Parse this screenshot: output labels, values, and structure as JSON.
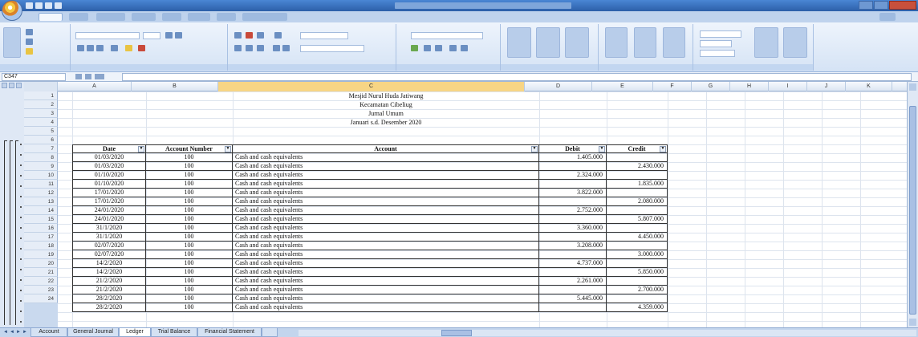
{
  "formula_bar": {
    "name_box": "C347",
    "formula": ""
  },
  "columns": [
    "A",
    "B",
    "C",
    "D",
    "E",
    "F",
    "G",
    "H",
    "I",
    "J",
    "K"
  ],
  "selected_column": "C",
  "report": {
    "title_lines": [
      "Mesjid Nurul Huda Jatiwang",
      "Kecamatan Cibeliug",
      "Jurnal Umum",
      "Januari s.d. Desember 2020"
    ]
  },
  "table": {
    "headers": [
      "Date",
      "Account Number",
      "Account",
      "Debit",
      "Credit"
    ],
    "rows": [
      {
        "row": "1",
        "date": "",
        "acct_no": "",
        "account": "",
        "debit": "",
        "credit": ""
      },
      {
        "row": "7",
        "date": "01/03/2020",
        "acct_no": "100",
        "account": "Cash and cash equivalents",
        "debit": "1.405.000",
        "credit": ""
      },
      {
        "row": "8",
        "date": "01/03/2020",
        "acct_no": "100",
        "account": "Cash and cash equivalents",
        "debit": "",
        "credit": "2.430.000"
      },
      {
        "row": "9",
        "date": "01/10/2020",
        "acct_no": "100",
        "account": "Cash and cash equivalents",
        "debit": "2.324.000",
        "credit": ""
      },
      {
        "row": "10",
        "date": "01/10/2020",
        "acct_no": "100",
        "account": "Cash and cash equivalents",
        "debit": "",
        "credit": "1.835.000"
      },
      {
        "row": "11",
        "date": "17/01/2020",
        "acct_no": "100",
        "account": "Cash and cash equivalents",
        "debit": "3.822.000",
        "credit": ""
      },
      {
        "row": "12",
        "date": "17/01/2020",
        "acct_no": "100",
        "account": "Cash and cash equivalents",
        "debit": "",
        "credit": "2.080.000"
      },
      {
        "row": "13",
        "date": "24/01/2020",
        "acct_no": "100",
        "account": "Cash and cash equivalents",
        "debit": "2.752.000",
        "credit": ""
      },
      {
        "row": "14",
        "date": "24/01/2020",
        "acct_no": "100",
        "account": "Cash and cash equivalents",
        "debit": "",
        "credit": "5.807.000"
      },
      {
        "row": "15",
        "date": "31/1/2020",
        "acct_no": "100",
        "account": "Cash and cash equivalents",
        "debit": "3.360.000",
        "credit": ""
      },
      {
        "row": "16",
        "date": "31/1/2020",
        "acct_no": "100",
        "account": "Cash and cash equivalents",
        "debit": "",
        "credit": "4.450.000"
      },
      {
        "row": "17",
        "date": "02/07/2020",
        "acct_no": "100",
        "account": "Cash and cash equivalents",
        "debit": "3.208.000",
        "credit": ""
      },
      {
        "row": "18",
        "date": "02/07/2020",
        "acct_no": "100",
        "account": "Cash and cash equivalents",
        "debit": "",
        "credit": "3.000.000"
      },
      {
        "row": "19",
        "date": "14/2/2020",
        "acct_no": "100",
        "account": "Cash and cash equivalents",
        "debit": "4.737.000",
        "credit": ""
      },
      {
        "row": "20",
        "date": "14/2/2020",
        "acct_no": "100",
        "account": "Cash and cash equivalents",
        "debit": "",
        "credit": "5.850.000"
      },
      {
        "row": "21",
        "date": "21/2/2020",
        "acct_no": "100",
        "account": "Cash and cash equivalents",
        "debit": "2.261.000",
        "credit": ""
      },
      {
        "row": "22",
        "date": "21/2/2020",
        "acct_no": "100",
        "account": "Cash and cash equivalents",
        "debit": "",
        "credit": "2.700.000"
      },
      {
        "row": "23",
        "date": "28/2/2020",
        "acct_no": "100",
        "account": "Cash and cash equivalents",
        "debit": "5.445.000",
        "credit": ""
      },
      {
        "row": "24",
        "date": "28/2/2020",
        "acct_no": "100",
        "account": "Cash and cash equivalents",
        "debit": "",
        "credit": "4.359.000"
      }
    ]
  },
  "header_rows": [
    "1",
    "2",
    "3",
    "4",
    "5",
    "6"
  ],
  "sheet_tabs": [
    {
      "label": "Account",
      "active": false
    },
    {
      "label": "General Journal",
      "active": false
    },
    {
      "label": "Ledger",
      "active": true
    },
    {
      "label": "Trial Balance",
      "active": false
    },
    {
      "label": "Financial Statement",
      "active": false
    }
  ]
}
